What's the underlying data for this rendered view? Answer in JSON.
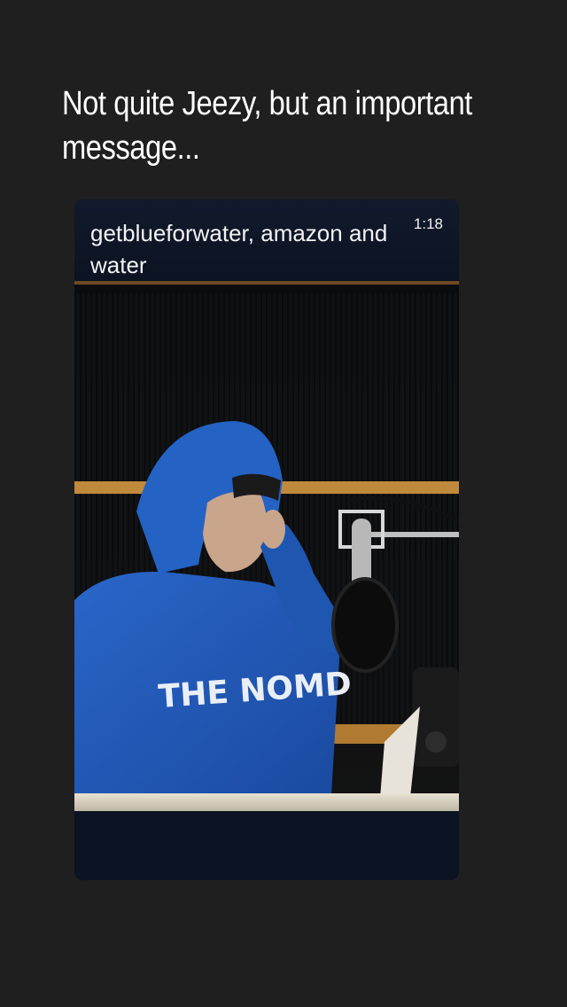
{
  "story": {
    "caption": "Not quite Jeezy, but an important message..."
  },
  "video": {
    "title": "getblueforwater, amazon and water",
    "duration": "1:18",
    "hoodie_text": "THE NOMD"
  },
  "colors": {
    "background": "#1f1f1f",
    "hoodie_blue": "#1f56b0",
    "wood_accent": "#c08a3c"
  }
}
